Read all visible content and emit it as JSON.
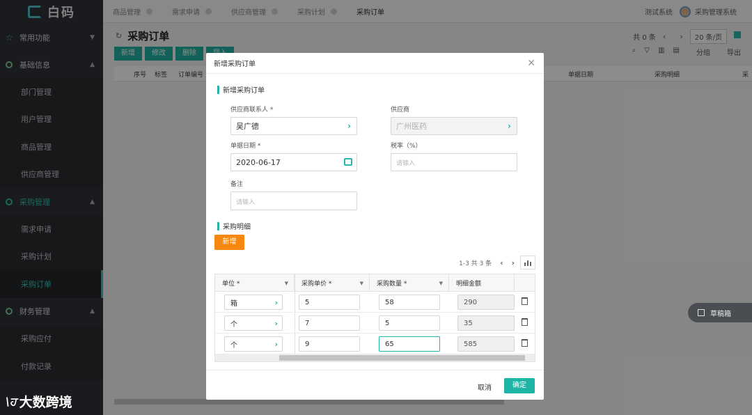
{
  "app": {
    "logo": "白码"
  },
  "sidebar": {
    "groups": [
      {
        "label": "常用功能"
      },
      {
        "label": "基础信息",
        "items": [
          "部门管理",
          "用户管理",
          "商品管理",
          "供应商管理"
        ]
      },
      {
        "label": "采购管理",
        "items": [
          "需求申请",
          "采购计划",
          "采购订单"
        ]
      },
      {
        "label": "财务管理",
        "items": [
          "采购应付",
          "付款记录"
        ]
      }
    ]
  },
  "watermark": {
    "mark": "\\ਹ",
    "text": "大数跨境"
  },
  "tabs": [
    "商品管理",
    "需求申请",
    "供应商管理",
    "采购计划",
    "采购订单"
  ],
  "topbar": {
    "system": "测试系统",
    "user": "采购管理系统"
  },
  "page": {
    "title": "采购订单",
    "pager": {
      "total": "共 0 条",
      "size": "20 条/页"
    },
    "toolbar": [
      "新增",
      "修改",
      "删除",
      "导入"
    ],
    "tools": {
      "group": "分组",
      "export": "导出"
    },
    "columns": [
      "序号",
      "标签",
      "订单编号",
      "单据日期",
      "采购明细",
      "采"
    ]
  },
  "drafts": {
    "label": "草稿箱"
  },
  "modal": {
    "title": "新增采购订单",
    "section1": "新增采购订单",
    "fields": {
      "contact_label": "供应商联系人 *",
      "contact_value": "吴广德",
      "supplier_label": "供应商",
      "supplier_value": "广州医药",
      "date_label": "单据日期 *",
      "date_value": "2020-06-17",
      "tax_label": "税率（%）",
      "tax_placeholder": "请输入",
      "remark_label": "备注",
      "remark_placeholder": "请输入"
    },
    "section2": "采购明细",
    "add_label": "新增",
    "sub_pager": {
      "range": "1-3 共 3 条"
    },
    "detail_columns": [
      "单位 *",
      "采购单价 *",
      "采购数量 *",
      "明细金额"
    ],
    "rows": [
      {
        "unit": "箱",
        "price": "5",
        "qty": "58",
        "amount": "290"
      },
      {
        "unit": "个",
        "price": "7",
        "qty": "5",
        "amount": "35"
      },
      {
        "unit": "个",
        "price": "9",
        "qty": "65",
        "amount": "585"
      }
    ],
    "cancel": "取消",
    "confirm": "确定"
  }
}
